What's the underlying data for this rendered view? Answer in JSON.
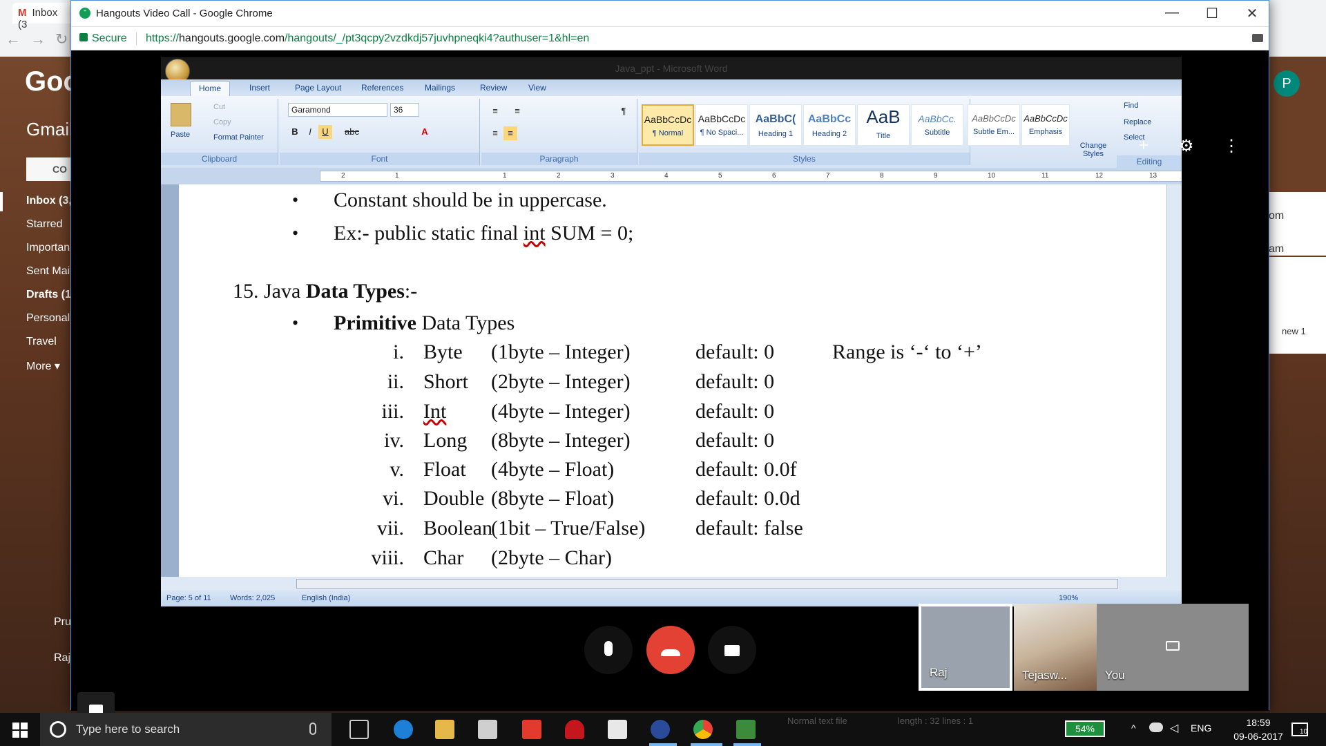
{
  "background": {
    "tab_label": "Inbox (3",
    "gmail_logo": "Goo",
    "gmail_title": "Gmail",
    "compose": "CO",
    "nav": [
      "Inbox (3,",
      "Starred",
      "Importan",
      "Sent Mai",
      "Drafts (1",
      "Personal",
      "Travel",
      "More ▾"
    ],
    "chat_contacts": [
      "Pru",
      "Raj"
    ],
    "right_snips": [
      "om",
      "am",
      "new 1"
    ]
  },
  "window": {
    "title": "Hangouts Video Call - Google Chrome",
    "secure_label": "Secure",
    "url_scheme": "https://",
    "url_host": "hangouts.google.com",
    "url_rest": "/hangouts/_/pt3qcpy2vzdkdj57juvhpneqki4?authuser=1&hl=en",
    "minimize": "—",
    "maximize": "☐",
    "close": "✕"
  },
  "word": {
    "title": "Java_ppt - Microsoft Word",
    "tabs": [
      "Home",
      "Insert",
      "Page Layout",
      "References",
      "Mailings",
      "Review",
      "View"
    ],
    "clipboard": {
      "paste": "Paste",
      "cut": "Cut",
      "copy": "Copy",
      "format_painter": "Format Painter",
      "label": "Clipboard"
    },
    "font": {
      "name": "Garamond",
      "size": "36",
      "label": "Font"
    },
    "paragraph_label": "Paragraph",
    "styles": [
      {
        "preview": "AaBbCcDc",
        "name": "¶ Normal"
      },
      {
        "preview": "AaBbCcDc",
        "name": "¶ No Spaci..."
      },
      {
        "preview": "AaBbC(",
        "name": "Heading 1"
      },
      {
        "preview": "AaBbCc",
        "name": "Heading 2"
      },
      {
        "preview": "AaB",
        "name": "Title"
      },
      {
        "preview": "AaBbCc.",
        "name": "Subtitle"
      },
      {
        "preview": "AaBbCcDc",
        "name": "Subtle Em..."
      },
      {
        "preview": "AaBbCcDc",
        "name": "Emphasis"
      }
    ],
    "styles_label": "Styles",
    "change_styles": "Change Styles",
    "editing": {
      "find": "Find",
      "replace": "Replace",
      "select": "Select",
      "label": "Editing"
    },
    "ruler_numbers": [
      "2",
      "1",
      "1",
      "1",
      "2",
      "3",
      "4",
      "5",
      "6",
      "7",
      "8",
      "9",
      "10",
      "11",
      "12",
      "13"
    ],
    "status": {
      "page": "Page: 5 of 11",
      "words": "Words: 2,025",
      "language": "English (India)",
      "zoom": "190%"
    }
  },
  "document": {
    "bullet1": "Constant should be in uppercase.",
    "bullet2_pre": "Ex:- public static final ",
    "bullet2_int": "int",
    "bullet2_post": " SUM = 0;",
    "heading_num": "15. Java ",
    "heading_bold": "Data Types",
    "heading_tail": ":-",
    "primitive_bold": "Primitive",
    "primitive_rest": " Data Types",
    "rows": [
      {
        "num": "i.",
        "type": "Byte",
        "size": "(1byte – Integer)",
        "default": "default: 0",
        "note": "Range is ‘-‘ to ‘+’"
      },
      {
        "num": "ii.",
        "type": "Short",
        "size": "(2byte – Integer)",
        "default": "default: 0",
        "note": ""
      },
      {
        "num": "iii.",
        "type": "Int",
        "size": "(4byte – Integer)",
        "default": "default: 0",
        "note": ""
      },
      {
        "num": "iv.",
        "type": "Long",
        "size": "(8byte – Integer)",
        "default": "default: 0",
        "note": ""
      },
      {
        "num": "v.",
        "type": "Float",
        "size": "(4byte – Float)",
        "default": "default: 0.0f",
        "note": ""
      },
      {
        "num": "vi.",
        "type": "Double",
        "size": "(8byte – Float)",
        "default": "default: 0.0d",
        "note": ""
      },
      {
        "num": "vii.",
        "type": "Boolean",
        "size": "(1bit – True/False)",
        "default": "default: false",
        "note": ""
      },
      {
        "num": "viii.",
        "type": "Char",
        "size": "(2byte – Char)",
        "default": "",
        "note": ""
      }
    ]
  },
  "hangouts": {
    "participants": [
      "Raj",
      "Tejasw...",
      "You"
    ],
    "avatar_letter": "P"
  },
  "taskbar": {
    "search_placeholder": "Type here to search",
    "tray_text": "Normal text file",
    "tray_len": "length : 32    lines : 1",
    "battery": "54%",
    "language": "ENG",
    "time": "18:59",
    "date": "09-06-2017",
    "notifications": "10"
  },
  "colors": {
    "hangup": "#e34133",
    "secure": "#0a8043",
    "word_blue": "#15428b"
  }
}
